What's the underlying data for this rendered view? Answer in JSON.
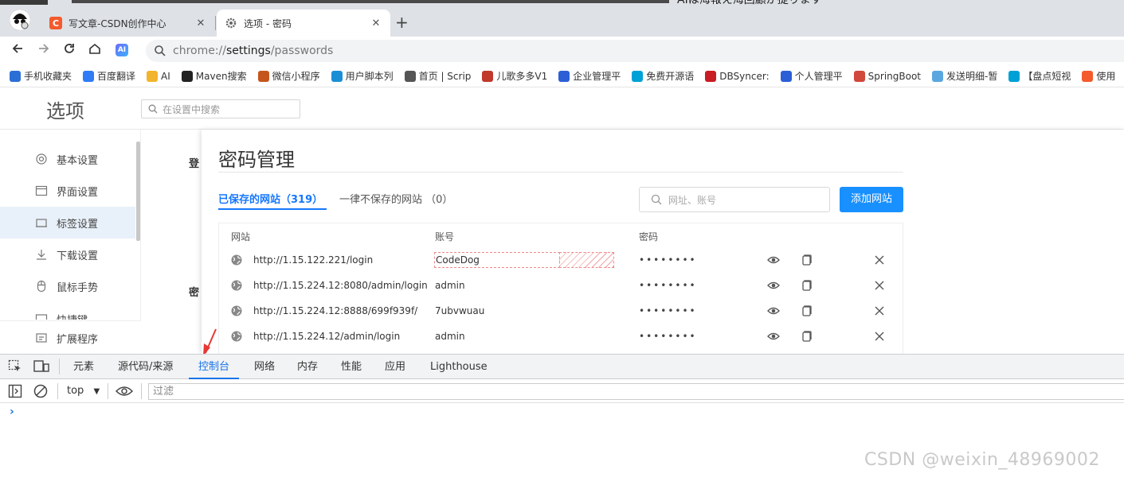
{
  "browser": {
    "tabs": [
      {
        "label": "写文章-CSDN创作中心",
        "favicon": "csdn-icon",
        "favicon_color": "#f55a2c",
        "active": false
      },
      {
        "label": "选项 - 密码",
        "favicon": "gear-icon",
        "favicon_color": "#666666",
        "active": true
      }
    ],
    "url": {
      "prefix": "chrome://",
      "host": "settings",
      "path": "/passwords"
    },
    "ai_badge": "AI",
    "background_text": "AIは海報え海回顧が提ります"
  },
  "bookmarks": [
    {
      "label": "手机收藏夹",
      "icon": "bookmark-icon",
      "color": "#2b6fd6"
    },
    {
      "label": "百度翻译",
      "icon": "baidu-translate-icon",
      "color": "#2f7cf6"
    },
    {
      "label": "AI",
      "icon": "folder-icon",
      "color": "#f2b42c"
    },
    {
      "label": "Maven搜索",
      "icon": "maven-icon",
      "color": "#222222"
    },
    {
      "label": "微信小程序",
      "icon": "wechat-mini-icon",
      "color": "#c4561d"
    },
    {
      "label": "用户脚本列",
      "icon": "script-icon",
      "color": "#1a8fd6"
    },
    {
      "label": "首页 | Scrip",
      "icon": "globe-icon",
      "color": "#555555"
    },
    {
      "label": "儿歌多多V1",
      "icon": "erge-icon",
      "color": "#c0392b"
    },
    {
      "label": "企业管理平",
      "icon": "u-icon",
      "color": "#2c5fd6"
    },
    {
      "label": "免费开源语",
      "icon": "bilibili-icon",
      "color": "#00a1d6"
    },
    {
      "label": "DBSyncer:",
      "icon": "gitee-icon",
      "color": "#c71d23"
    },
    {
      "label": "个人管理平",
      "icon": "u-icon",
      "color": "#2c5fd6"
    },
    {
      "label": "SpringBoot",
      "icon": "jb-icon",
      "color": "#d0493a"
    },
    {
      "label": "发送明细-暂",
      "icon": "sms-icon",
      "color": "#5aa7e0"
    },
    {
      "label": "【盘点短视",
      "icon": "bilibili-icon",
      "color": "#00a1d6"
    },
    {
      "label": "使用",
      "icon": "csdn-icon",
      "color": "#f55a2c"
    }
  ],
  "settings": {
    "title": "选项",
    "search_placeholder": "在设置中搜索",
    "sidebar": [
      {
        "label": "基本设置",
        "icon": "gear-icon",
        "active": false
      },
      {
        "label": "界面设置",
        "icon": "window-icon",
        "active": false
      },
      {
        "label": "标签设置",
        "icon": "tab-icon",
        "active": true
      },
      {
        "label": "下载设置",
        "icon": "download-icon",
        "active": false
      },
      {
        "label": "鼠标手势",
        "icon": "mouse-icon",
        "active": false
      },
      {
        "label": "快捷键",
        "icon": "keyboard-icon",
        "active": false
      }
    ],
    "sidebar_footer": {
      "label": "扩展程序",
      "icon": "extension-icon"
    },
    "content_peek": [
      "登",
      "密"
    ]
  },
  "password_manager": {
    "title": "密码管理",
    "tabs": {
      "saved": "已保存的网站（319）",
      "never": "一律不保存的网站 （0）"
    },
    "search_placeholder": "网址、账号",
    "add_button": "添加网站",
    "columns": {
      "site": "网站",
      "account": "账号",
      "password": "密码"
    },
    "rows": [
      {
        "site": "http://1.15.122.221/login",
        "account": "CodeDog",
        "password": "••••••••"
      },
      {
        "site": "http://1.15.224.12:8080/admin/login",
        "account": "admin",
        "password": "••••••••"
      },
      {
        "site": "http://1.15.224.12:8888/699f939f/",
        "account": "7ubvwuau",
        "password": "••••••••"
      },
      {
        "site": "http://1.15.224.12/admin/login",
        "account": "admin",
        "password": "••••••••"
      }
    ]
  },
  "devtools": {
    "tabs": [
      "元素",
      "源代码/来源",
      "控制台",
      "网络",
      "内存",
      "性能",
      "应用",
      "Lighthouse"
    ],
    "active_tab": "控制台",
    "context": "top",
    "filter_placeholder": "过滤",
    "prompt": "›"
  },
  "watermark": "CSDN @weixin_48969002",
  "colors": {
    "accent": "#1890ff",
    "devtools_accent": "#1a73e8",
    "annotation_arrow": "#e53935"
  }
}
